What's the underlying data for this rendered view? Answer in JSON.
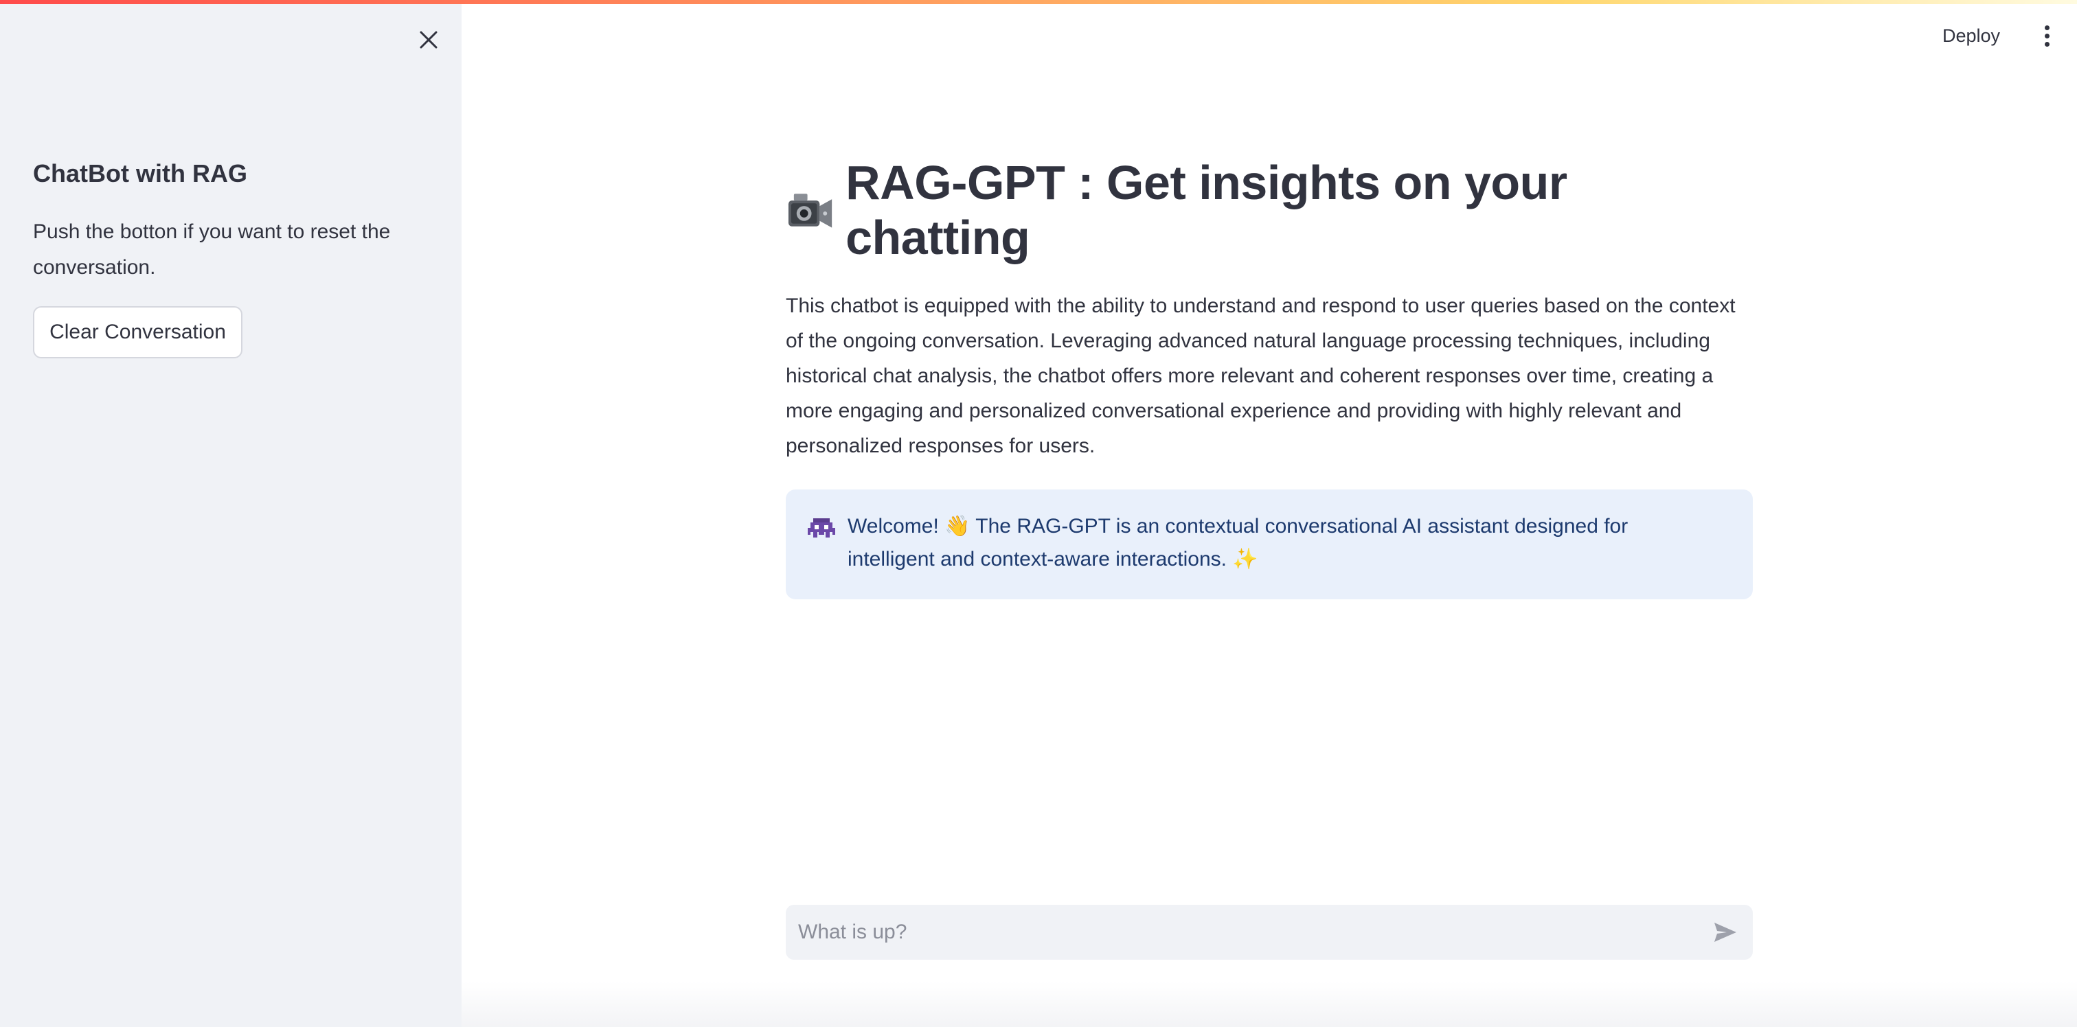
{
  "header": {
    "deploy_label": "Deploy"
  },
  "sidebar": {
    "title": "ChatBot with RAG",
    "description": "Push the botton if you want to reset the conversation.",
    "clear_button_label": "Clear Conversation"
  },
  "main": {
    "title": "RAG-GPT : Get insights on your chatting",
    "title_icon": "video-camera-icon",
    "intro": "This chatbot is equipped with the ability to understand and respond to user queries based on the context of the ongoing conversation. Leveraging advanced natural language processing techniques, including historical chat analysis, the chatbot offers more relevant and coherent responses over time, creating a more engaging and personalized conversational experience and providing with highly relevant and personalized responses for users.",
    "assistant_message": {
      "avatar_icon": "alien-monster-icon",
      "text": "Welcome! 👋 The RAG-GPT is an contextual conversational AI assistant designed for intelligent and context-aware interactions. ✨"
    }
  },
  "chat_input": {
    "placeholder": "What is up?",
    "value": ""
  },
  "colors": {
    "sidebar_bg": "#f0f2f6",
    "info_bg": "#e9f0fb",
    "info_text": "#1d3a6e",
    "accent": "#ff4b4b"
  }
}
